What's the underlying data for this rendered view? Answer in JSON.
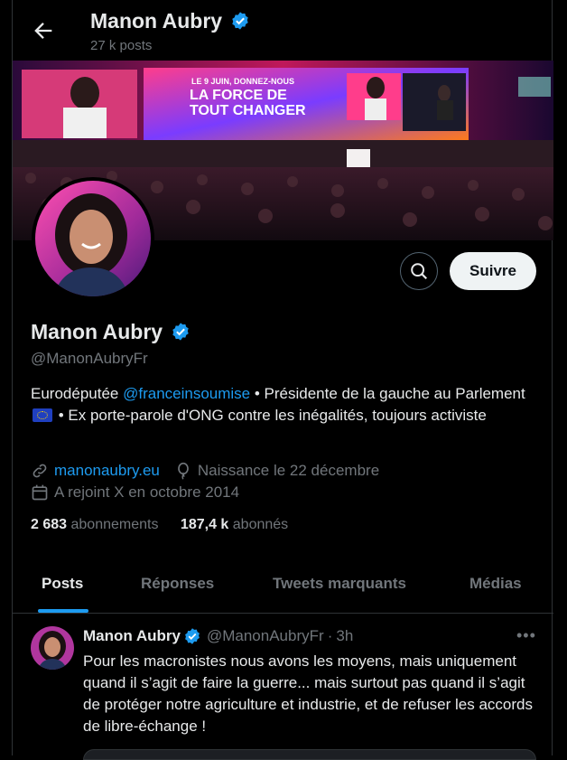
{
  "header": {
    "name": "Manon Aubry",
    "posts_count": "27 k posts"
  },
  "banner": {
    "slogan_line1": "LE 9 JUIN, DONNEZ-NOUS",
    "slogan_line2": "LA FORCE DE",
    "slogan_line3": "TOUT CHANGER"
  },
  "actions": {
    "follow_label": "Suivre"
  },
  "profile": {
    "name": "Manon Aubry",
    "handle": "@ManonAubryFr",
    "bio_part1": "Eurodéputée ",
    "bio_mention": "@franceinsoumise",
    "bio_part2": " • Présidente de la gauche au Parlement ",
    "bio_part3": " • Ex porte-parole d'ONG contre les inégalités, toujours activiste",
    "website": "manonaubry.eu",
    "birthday": "Naissance le 22 décembre",
    "joined": "A rejoint X en octobre 2014",
    "following_count": "2 683",
    "following_label": "abonnements",
    "followers_count": "187,4 k",
    "followers_label": "abonnés"
  },
  "tabs": [
    {
      "label": "Posts"
    },
    {
      "label": "Réponses"
    },
    {
      "label": "Tweets marquants"
    },
    {
      "label": "Médias"
    }
  ],
  "post": {
    "author": "Manon Aubry",
    "handle": "@ManonAubryFr",
    "time": "3h",
    "text": "Pour les macronistes nous avons les moyens, mais uniquement quand il s’agit de faire la guerre... mais surtout pas quand il s’agit de protéger notre agriculture et industrie, et de refuser les accords de libre-échange !"
  },
  "colors": {
    "accent": "#1d9bf0",
    "verified": "#1d9bf0",
    "background": "#000000",
    "muted": "#71767b"
  }
}
